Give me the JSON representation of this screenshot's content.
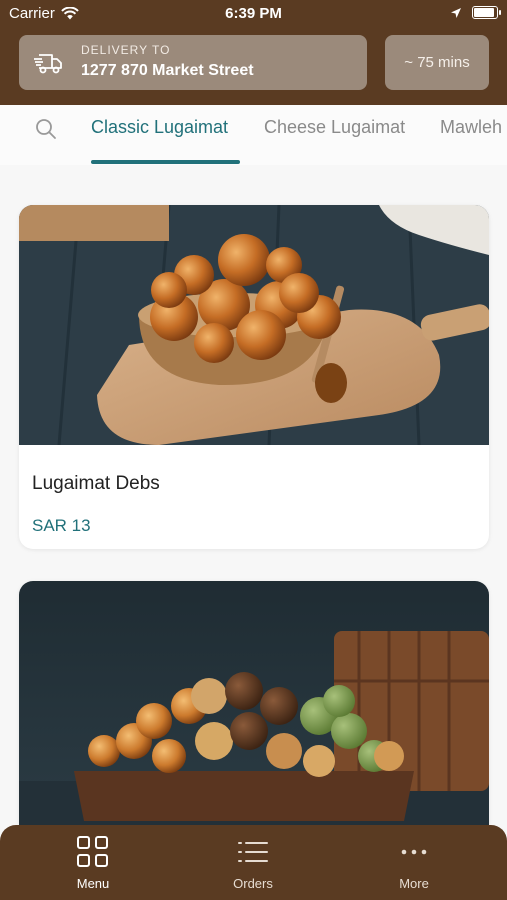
{
  "status": {
    "carrier": "Carrier",
    "time": "6:39 PM"
  },
  "header": {
    "delivery_label": "DELIVERY TO",
    "delivery_address": "1277 870 Market Street",
    "eta": "~ 75 mins"
  },
  "tabs": [
    {
      "label": "Classic Lugaimat",
      "active": true
    },
    {
      "label": "Cheese Lugaimat",
      "active": false
    },
    {
      "label": "Mawleh",
      "active": false
    }
  ],
  "products": [
    {
      "title": "Lugaimat Debs",
      "price": "SAR 13",
      "image": "lugaimat-bowl-photo"
    },
    {
      "title": "",
      "price": "",
      "image": "assorted-lugaimat-platter-photo"
    }
  ],
  "bottom_nav": [
    {
      "label": "Menu",
      "icon": "grid-icon",
      "active": true
    },
    {
      "label": "Orders",
      "icon": "list-icon",
      "active": false
    },
    {
      "label": "More",
      "icon": "more-dots-icon",
      "active": false
    }
  ],
  "colors": {
    "brand_brown": "#5a3b22",
    "accent_teal": "#21717a",
    "header_box": "#9b8a7b"
  }
}
